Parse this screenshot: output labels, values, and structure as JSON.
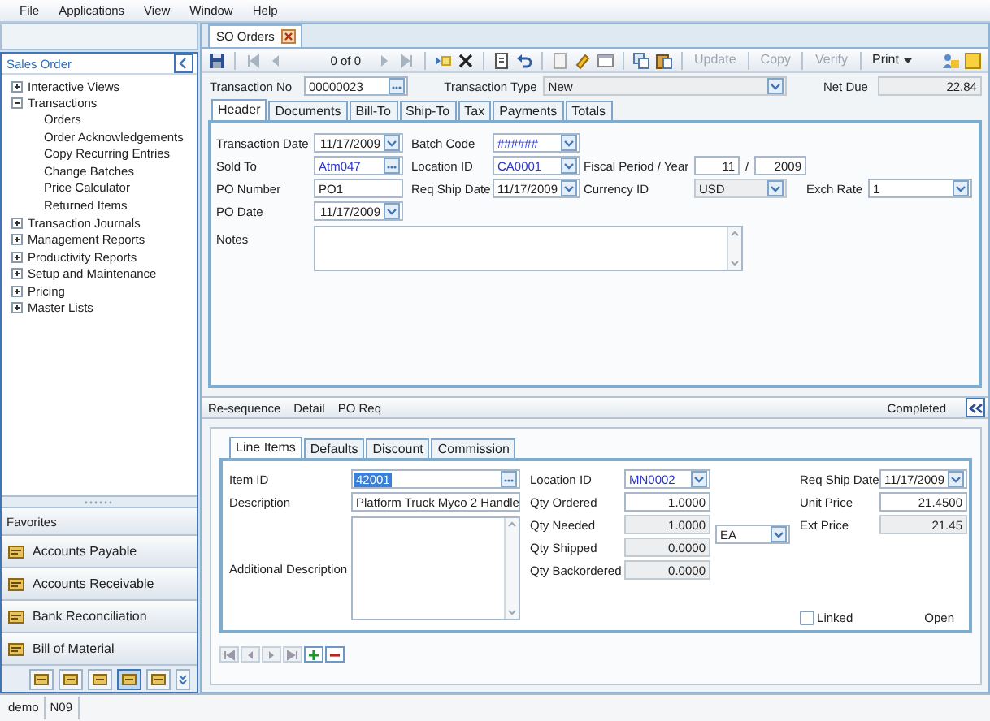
{
  "menu": [
    "File",
    "Applications",
    "View",
    "Window",
    "Help"
  ],
  "sidebar": {
    "title": "Sales Order",
    "tree": [
      {
        "label": "Interactive Views",
        "expanded": false
      },
      {
        "label": "Transactions",
        "expanded": true,
        "children": [
          {
            "label": "Orders"
          },
          {
            "label": "Order Acknowledgements"
          },
          {
            "label": "Copy Recurring Entries"
          },
          {
            "label": "Change Batches"
          },
          {
            "label": "Price Calculator"
          },
          {
            "label": "Returned Items"
          }
        ]
      },
      {
        "label": "Transaction Journals",
        "expanded": false
      },
      {
        "label": "Management Reports",
        "expanded": false
      },
      {
        "label": "Productivity Reports",
        "expanded": false
      },
      {
        "label": "Setup and Maintenance",
        "expanded": false
      },
      {
        "label": "Pricing",
        "expanded": false
      },
      {
        "label": "Master Lists",
        "expanded": false
      }
    ],
    "favorites": "Favorites",
    "modules": [
      {
        "label": "Accounts Payable"
      },
      {
        "label": "Accounts Receivable"
      },
      {
        "label": "Bank Reconciliation"
      },
      {
        "label": "Bill of Material"
      }
    ],
    "shortcuts": [
      {
        "selected": false
      },
      {
        "selected": false
      },
      {
        "selected": false
      },
      {
        "selected": true
      },
      {
        "selected": false
      }
    ]
  },
  "document_tabs": [
    {
      "label": "SO Orders",
      "selected": true
    }
  ],
  "toolbar": {
    "record_counter": "0 of 0",
    "actions": [
      {
        "label": "Update",
        "disabled": true
      },
      {
        "label": "Copy",
        "disabled": true
      },
      {
        "label": "Verify",
        "disabled": true
      },
      {
        "label": "Print",
        "disabled": false,
        "menu": true
      }
    ]
  },
  "transaction": [
    {
      "label": "Transaction No",
      "value": "00000023",
      "kind": "lookup"
    },
    {
      "label": "Transaction Type",
      "value": "New",
      "kind": "combo",
      "disabled": true
    },
    {
      "label": "Net Due",
      "value": "22.84",
      "kind": "number",
      "disabled": true
    }
  ],
  "header_tabs": [
    {
      "label": "Header",
      "selected": true
    },
    {
      "label": "Documents",
      "selected": false
    },
    {
      "label": "Bill-To",
      "selected": false
    },
    {
      "label": "Ship-To",
      "selected": false
    },
    {
      "label": "Tax",
      "selected": false
    },
    {
      "label": "Payments",
      "selected": false
    },
    {
      "label": "Totals",
      "selected": false
    }
  ],
  "header_rows": [
    [
      {
        "label": "Transaction Date",
        "value": "11/17/2009",
        "kind": "date"
      },
      {
        "label": "Batch Code",
        "value": "######",
        "kind": "combo",
        "link": true
      }
    ],
    [
      {
        "label": "Sold To",
        "value": "Atm047",
        "kind": "lookup",
        "link": true
      },
      {
        "label": "Location ID",
        "value": "CA0001",
        "kind": "combo",
        "link": true
      },
      {
        "label": "Fiscal Period / Year",
        "kind": "period",
        "values": [
          "11",
          "2009"
        ],
        "separator": "/"
      }
    ],
    [
      {
        "label": "PO Number",
        "value": "PO1",
        "kind": "text"
      },
      {
        "label": "Req Ship Date",
        "value": "11/17/2009",
        "kind": "date"
      },
      {
        "label": "Currency ID",
        "value": "USD",
        "kind": "combo",
        "disabled": true
      },
      {
        "label": "Exch Rate",
        "value": "1",
        "kind": "combo"
      }
    ],
    [
      {
        "label": "PO Date",
        "value": "11/17/2009",
        "kind": "date"
      }
    ]
  ],
  "notes": {
    "label": "Notes"
  },
  "detail_bar": {
    "links": [
      "Re-sequence",
      "Detail",
      "PO Req"
    ],
    "status": "Completed"
  },
  "line_tabs": [
    {
      "label": "Line Items",
      "selected": true
    },
    {
      "label": "Defaults",
      "selected": false
    },
    {
      "label": "Discount",
      "selected": false
    },
    {
      "label": "Commission",
      "selected": false
    }
  ],
  "line_left": [
    {
      "label": "Item ID",
      "value": "42001",
      "kind": "lookup",
      "highlighted": true
    },
    {
      "label": "Description",
      "value": "Platform Truck Myco 2 Handle",
      "kind": "text"
    },
    {
      "label": "Additional Description",
      "kind": "memo"
    }
  ],
  "line_middle": [
    {
      "label": "Location ID",
      "value": "MN0002",
      "kind": "combo",
      "link": true
    },
    {
      "label": "Qty Ordered",
      "value": "1.0000",
      "kind": "number"
    },
    {
      "label": "Qty Needed",
      "value": "1.0000",
      "kind": "number",
      "disabled": true
    },
    {
      "label": "Qty Shipped",
      "value": "0.0000",
      "kind": "number",
      "disabled": true
    },
    {
      "label": "Qty Backordered",
      "value": "0.0000",
      "kind": "number",
      "disabled": true
    }
  ],
  "unit": {
    "value": "EA",
    "kind": "combo"
  },
  "line_right": [
    {
      "label": "Req Ship Date",
      "value": "11/17/2009",
      "kind": "date"
    },
    {
      "label": "Unit Price",
      "value": "21.4500",
      "kind": "number"
    },
    {
      "label": "Ext Price",
      "value": "21.45",
      "kind": "number",
      "disabled": true
    }
  ],
  "linked": {
    "label": "Linked",
    "checked": false
  },
  "line_status": "Open",
  "status_bar": [
    "demo",
    "N09"
  ]
}
